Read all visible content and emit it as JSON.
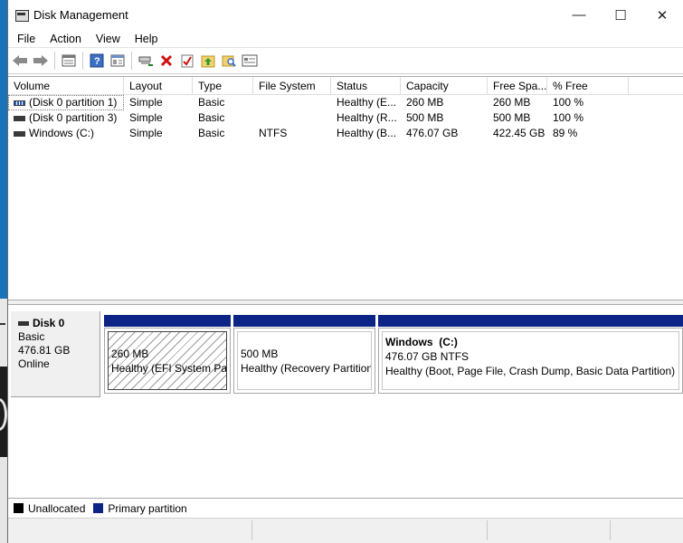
{
  "window": {
    "title": "Disk Management",
    "controls": {
      "minimize": "—",
      "maximize": "☐",
      "close": "✕"
    }
  },
  "menu": [
    "File",
    "Action",
    "View",
    "Help"
  ],
  "toolbar": {
    "icons": [
      "back-arrow-icon",
      "forward-arrow-icon",
      "disk-list-icon",
      "help-icon",
      "properties-icon",
      "connect-icon",
      "delete-icon",
      "check-icon",
      "folder-up-icon",
      "search-folder-icon",
      "console-icon"
    ]
  },
  "volume_list": {
    "columns": [
      "Volume",
      "Layout",
      "Type",
      "File System",
      "Status",
      "Capacity",
      "Free Spa...",
      "% Free"
    ],
    "rows": [
      {
        "volume": "(Disk 0 partition 1)",
        "layout": "Simple",
        "type": "Basic",
        "fs": "",
        "status": "Healthy (E...",
        "capacity": "260 MB",
        "free": "260 MB",
        "pct": "100 %",
        "icon": "striped-volume-icon"
      },
      {
        "volume": "(Disk 0 partition 3)",
        "layout": "Simple",
        "type": "Basic",
        "fs": "",
        "status": "Healthy (R...",
        "capacity": "500 MB",
        "free": "500 MB",
        "pct": "100 %",
        "icon": "volume-icon"
      },
      {
        "volume": "Windows (C:)",
        "layout": "Simple",
        "type": "Basic",
        "fs": "NTFS",
        "status": "Healthy (B...",
        "capacity": "476.07 GB",
        "free": "422.45 GB",
        "pct": "89 %",
        "icon": "volume-icon"
      }
    ]
  },
  "disk": {
    "name": "Disk 0",
    "type": "Basic",
    "size": "476.81 GB",
    "state": "Online",
    "partitions": [
      {
        "name": "",
        "size": "260 MB",
        "status": "Healthy (EFI System Part"
      },
      {
        "name": "",
        "size": "500 MB",
        "status": "Healthy (Recovery Partition"
      },
      {
        "name": "Windows  (C:)",
        "size": "476.07 GB NTFS",
        "status": "Healthy (Boot, Page File, Crash Dump, Basic Data Partition)"
      }
    ]
  },
  "legend": [
    {
      "label": "Unallocated",
      "color": "#000000"
    },
    {
      "label": "Primary partition",
      "color": "#0b2486"
    }
  ]
}
